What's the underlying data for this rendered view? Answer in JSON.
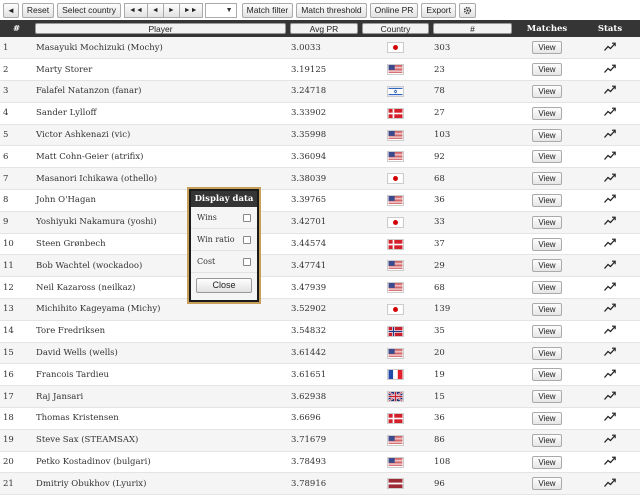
{
  "toolbar": {
    "back_icon": "back-arrow-icon",
    "reset": "Reset",
    "select_country": "Select country",
    "nav_first": "◄◄",
    "nav_prev": "◄",
    "nav_next": "►",
    "nav_last": "►►",
    "page_select": "▼",
    "match_filter": "Match filter",
    "match_threshold": "Match threshold",
    "online_pr": "Online PR",
    "export": "Export",
    "settings_icon": "gear-icon"
  },
  "table": {
    "headers": {
      "rank": "#",
      "player": "Player",
      "avg_pr": "Avg PR",
      "country": "Country",
      "count": "#",
      "matches": "Matches",
      "stats": "Stats"
    },
    "view_label": "View",
    "rows": [
      {
        "rank": "1",
        "player": "Masayuki Mochizuki (Mochy)",
        "pr": "3.0033",
        "flag": "jp",
        "count": "303"
      },
      {
        "rank": "2",
        "player": "Marty Storer",
        "pr": "3.19125",
        "flag": "us",
        "count": "23"
      },
      {
        "rank": "3",
        "player": "Falafel Natanzon (fanar)",
        "pr": "3.24718",
        "flag": "il",
        "count": "78"
      },
      {
        "rank": "4",
        "player": "Sander Lylloff",
        "pr": "3.33902",
        "flag": "dk",
        "count": "27"
      },
      {
        "rank": "5",
        "player": "Victor Ashkenazi (vic)",
        "pr": "3.35998",
        "flag": "us",
        "count": "103"
      },
      {
        "rank": "6",
        "player": "Matt Cohn-Geier (atrifix)",
        "pr": "3.36094",
        "flag": "us",
        "count": "92"
      },
      {
        "rank": "7",
        "player": "Masanori Ichikawa (othello)",
        "pr": "3.38039",
        "flag": "jp",
        "count": "68"
      },
      {
        "rank": "8",
        "player": "John O'Hagan",
        "pr": "3.39765",
        "flag": "us",
        "count": "36"
      },
      {
        "rank": "9",
        "player": "Yoshiyuki Nakamura (yoshi)",
        "pr": "3.42701",
        "flag": "jp",
        "count": "33"
      },
      {
        "rank": "10",
        "player": "Steen Grønbech",
        "pr": "3.44574",
        "flag": "dk",
        "count": "37"
      },
      {
        "rank": "11",
        "player": "Bob Wachtel (wockadoo)",
        "pr": "3.47741",
        "flag": "us",
        "count": "29"
      },
      {
        "rank": "12",
        "player": "Neil Kazaross (neilkaz)",
        "pr": "3.47939",
        "flag": "us",
        "count": "68"
      },
      {
        "rank": "13",
        "player": "Michihito Kageyama (Michy)",
        "pr": "3.52902",
        "flag": "jp",
        "count": "139"
      },
      {
        "rank": "14",
        "player": "Tore Fredriksen",
        "pr": "3.54832",
        "flag": "no",
        "count": "35"
      },
      {
        "rank": "15",
        "player": "David Wells (wells)",
        "pr": "3.61442",
        "flag": "us",
        "count": "20"
      },
      {
        "rank": "16",
        "player": "Francois Tardieu",
        "pr": "3.61651",
        "flag": "fr",
        "count": "19"
      },
      {
        "rank": "17",
        "player": "Raj Jansari",
        "pr": "3.62938",
        "flag": "gb",
        "count": "15"
      },
      {
        "rank": "18",
        "player": "Thomas Kristensen",
        "pr": "3.6696",
        "flag": "dk",
        "count": "36"
      },
      {
        "rank": "19",
        "player": "Steve Sax (STEAMSAX)",
        "pr": "3.71679",
        "flag": "us",
        "count": "86"
      },
      {
        "rank": "20",
        "player": "Petko Kostadinov (bulgari)",
        "pr": "3.78493",
        "flag": "us",
        "count": "108"
      },
      {
        "rank": "21",
        "player": "Dmitriy Obukhov (Lyurix)",
        "pr": "3.78916",
        "flag": "lv",
        "count": "96"
      }
    ]
  },
  "popup": {
    "title": "Display data",
    "options": [
      {
        "label": "Wins",
        "checked": false
      },
      {
        "label": "Win ratio",
        "checked": false
      },
      {
        "label": "Cost",
        "checked": false
      }
    ],
    "close_label": "Close"
  },
  "colors": {
    "header_bg": "#353535",
    "popup_border": "#c79e5a"
  }
}
